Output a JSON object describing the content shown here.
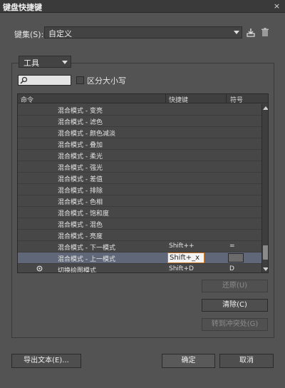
{
  "window": {
    "title": "键盘快捷键",
    "close_glyph": "×"
  },
  "set": {
    "label": "键集(S):",
    "value": "自定义"
  },
  "area": {
    "value": "工具"
  },
  "search": {
    "value": "",
    "case_label": "区分大小写"
  },
  "table": {
    "columns": [
      "命令",
      "快捷键",
      "符号"
    ],
    "rows": [
      {
        "cmd": "混合模式 - 变亮",
        "key": "",
        "sym": "",
        "selected": false
      },
      {
        "cmd": "混合模式 - 滤色",
        "key": "",
        "sym": "",
        "selected": false
      },
      {
        "cmd": "混合模式 - 颜色减淡",
        "key": "",
        "sym": "",
        "selected": false
      },
      {
        "cmd": "混合模式 - 叠加",
        "key": "",
        "sym": "",
        "selected": false
      },
      {
        "cmd": "混合模式 - 柔光",
        "key": "",
        "sym": "",
        "selected": false
      },
      {
        "cmd": "混合模式 - 强光",
        "key": "",
        "sym": "",
        "selected": false
      },
      {
        "cmd": "混合模式 - 差值",
        "key": "",
        "sym": "",
        "selected": false
      },
      {
        "cmd": "混合模式 - 排除",
        "key": "",
        "sym": "",
        "selected": false
      },
      {
        "cmd": "混合模式 - 色相",
        "key": "",
        "sym": "",
        "selected": false
      },
      {
        "cmd": "混合模式 - 饱和度",
        "key": "",
        "sym": "",
        "selected": false
      },
      {
        "cmd": "混合模式 - 混色",
        "key": "",
        "sym": "",
        "selected": false
      },
      {
        "cmd": "混合模式 - 亮度",
        "key": "",
        "sym": "",
        "selected": false
      },
      {
        "cmd": "混合模式 - 下一模式",
        "key": "Shift++",
        "sym": "=",
        "selected": false
      },
      {
        "cmd": "混合模式 - 上一模式",
        "key": "Shift+_x",
        "sym": "",
        "selected": true
      },
      {
        "cmd": "切换绘图模式",
        "key": "Shift+D",
        "sym": "D",
        "selected": false,
        "icon": "workspace-icon"
      }
    ]
  },
  "buttons": {
    "undo": "还原(U)",
    "clear": "清除(C)",
    "goto_conflict": "转到冲突处(G)",
    "export": "导出文本(E)...",
    "ok": "确定",
    "cancel": "取消"
  },
  "icons": {
    "save": "save-set-icon",
    "delete": "delete-set-icon",
    "search": "search-icon"
  },
  "colors": {
    "background": "#535353",
    "selection": "#5f6778",
    "focus_border": "#c87c2c"
  }
}
